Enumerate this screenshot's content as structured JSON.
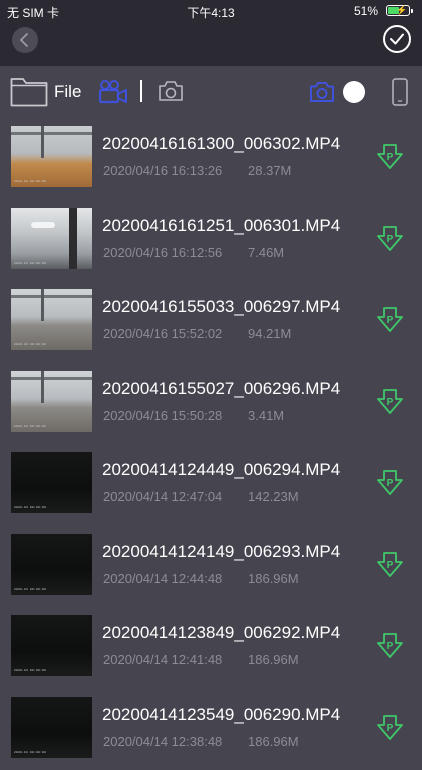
{
  "status_bar": {
    "carrier": "无 SIM 卡",
    "time": "下午4:13",
    "battery_percent": "51%",
    "battery_level": 0.51
  },
  "toolbar": {
    "file_label": "File"
  },
  "colors": {
    "accent": "#3f52d9",
    "download_green": "#3fc86a",
    "background": "#46454f",
    "bar_background": "#2b2a33",
    "secondary_text": "#8d8c95"
  },
  "icons": {
    "back": "chevron-left-icon",
    "confirm": "checkmark-icon",
    "folder": "folder-icon",
    "video": "video-camera-icon",
    "photo": "photo-camera-icon",
    "phone": "phone-icon",
    "download": "download-p-icon"
  },
  "files": [
    {
      "name": "20200416161300_006302.MP4",
      "date": "2020/04/16 16:13:26",
      "size": "28.37M",
      "thumb": "room sunset"
    },
    {
      "name": "20200416161251_006301.MP4",
      "date": "2020/04/16 16:12:56",
      "size": "7.46M",
      "thumb": "ceiling"
    },
    {
      "name": "20200416155033_006297.MP4",
      "date": "2020/04/16 15:52:02",
      "size": "94.21M",
      "thumb": "room"
    },
    {
      "name": "20200416155027_006296.MP4",
      "date": "2020/04/16 15:50:28",
      "size": "3.41M",
      "thumb": "room"
    },
    {
      "name": "20200414124449_006294.MP4",
      "date": "2020/04/14 12:47:04",
      "size": "142.23M",
      "thumb": "dark"
    },
    {
      "name": "20200414124149_006293.MP4",
      "date": "2020/04/14 12:44:48",
      "size": "186.96M",
      "thumb": "dark"
    },
    {
      "name": "20200414123849_006292.MP4",
      "date": "2020/04/14 12:41:48",
      "size": "186.96M",
      "thumb": "dark"
    },
    {
      "name": "20200414123549_006290.MP4",
      "date": "2020/04/14 12:38:48",
      "size": "186.96M",
      "thumb": "dark"
    }
  ]
}
